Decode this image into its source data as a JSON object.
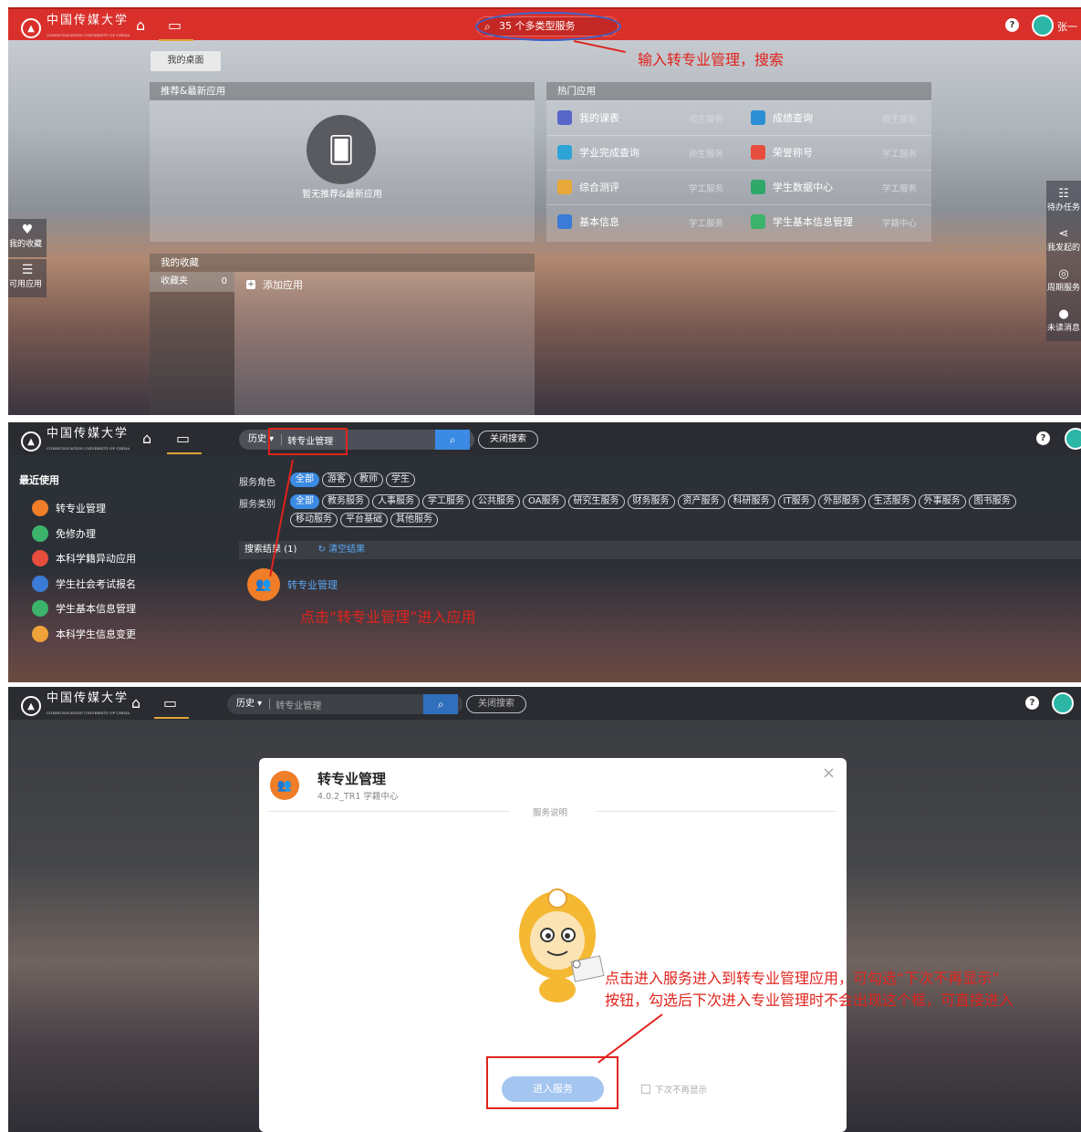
{
  "topbar": {
    "logo_text": "中国传媒大学",
    "logo_sub": "COMMUNICATION UNIVERSITY OF CHINA",
    "user_name": "张一"
  },
  "panel1": {
    "search_placeholder": "35 个多类型服务",
    "note": "输入转专业管理，搜索",
    "desk_tab": "我的桌面",
    "recommend": {
      "title": "推荐&最新应用",
      "empty": "暂无推荐&最新应用"
    },
    "hot": {
      "title": "热门应用",
      "rows": [
        [
          {
            "name": "我的课表",
            "cat": "师生服务",
            "color": "#5866c9"
          },
          {
            "name": "成绩查询",
            "cat": "师生服务",
            "color": "#2c8fd6"
          }
        ],
        [
          {
            "name": "学业完成查询",
            "cat": "师生服务",
            "color": "#2ea3d8"
          },
          {
            "name": "荣誉称号",
            "cat": "学工服务",
            "color": "#e64d3d"
          }
        ],
        [
          {
            "name": "综合测评",
            "cat": "学工服务",
            "color": "#e8a83a"
          },
          {
            "name": "学生数据中心",
            "cat": "学工服务",
            "color": "#2fa86a"
          }
        ],
        [
          {
            "name": "基本信息",
            "cat": "学工服务",
            "color": "#3b7bd8"
          },
          {
            "name": "学生基本信息管理",
            "cat": "学籍中心",
            "color": "#3bb36b"
          }
        ]
      ]
    },
    "favorites": {
      "title": "我的收藏",
      "folder": "收藏夹",
      "count": "0",
      "add": "添加应用"
    },
    "left_float": [
      {
        "label": "我的收藏",
        "icon": "heart-icon"
      },
      {
        "label": "可用应用",
        "icon": "list-icon"
      }
    ],
    "right_float": [
      {
        "label": "待办任务",
        "icon": "task-icon"
      },
      {
        "label": "我发起的",
        "icon": "share-icon"
      },
      {
        "label": "周期服务",
        "icon": "cycle-icon"
      },
      {
        "label": "未读消息",
        "icon": "message-icon"
      }
    ]
  },
  "panel2": {
    "history": "历史",
    "query": "转专业管理",
    "close_search": "关闭搜索",
    "recent_title": "最近使用",
    "recent": [
      {
        "name": "转专业管理",
        "color": "#f07d28"
      },
      {
        "name": "免修办理",
        "color": "#3bb36b"
      },
      {
        "name": "本科学籍异动应用",
        "color": "#e64d3d"
      },
      {
        "name": "学生社会考试报名",
        "color": "#3b7bd8"
      },
      {
        "name": "学生基本信息管理",
        "color": "#3bb36b"
      },
      {
        "name": "本科学生信息变更",
        "color": "#f0a23a"
      }
    ],
    "role_label": "服务角色",
    "roles": [
      "全部",
      "游客",
      "教师",
      "学生"
    ],
    "type_label": "服务类别",
    "types": [
      "全部",
      "教务服务",
      "人事服务",
      "学工服务",
      "公共服务",
      "OA服务",
      "研究生服务",
      "财务服务",
      "资产服务",
      "科研服务",
      "IT服务",
      "外部服务",
      "生活服务",
      "外事服务",
      "图书服务",
      "移动服务",
      "平台基础",
      "其他服务"
    ],
    "result_label": "搜索结果",
    "result_count": "(1)",
    "clear": "清空结果",
    "result_app": "转专业管理",
    "note": "点击“转专业管理”进入应用"
  },
  "panel3": {
    "history": "历史",
    "query": "转专业管理",
    "close_search": "关闭搜索",
    "modal": {
      "title": "转专业管理",
      "sub": "4.0.2_TR1 学籍中心",
      "section": "服务说明",
      "enter": "进入服务",
      "no_show": "下次不再显示"
    },
    "note_line1": "点击进入服务进入到转专业管理应用，可勾选“下次不再显示”",
    "note_line2": "按钮，勾选后下次进入专业管理时不会出现这个框，可直接进入"
  }
}
